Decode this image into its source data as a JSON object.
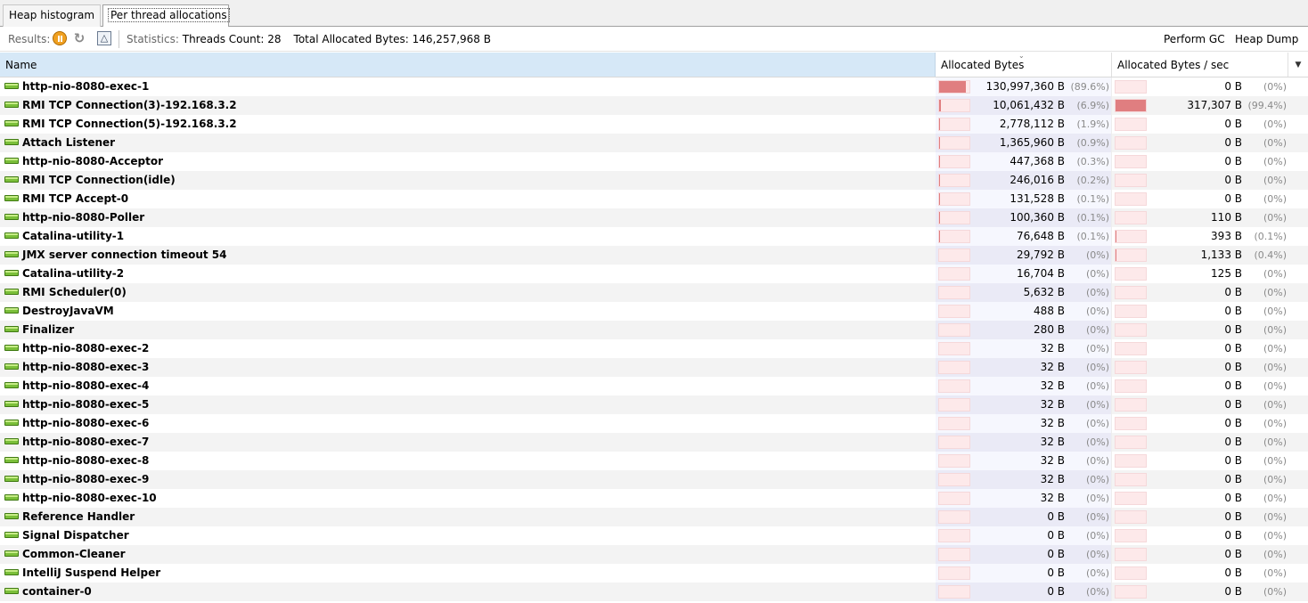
{
  "tabs": [
    {
      "label": "Heap histogram",
      "active": false
    },
    {
      "label": "Per thread allocations",
      "active": true
    }
  ],
  "toolbar": {
    "results_label": "Results:",
    "icons": [
      "pause-icon",
      "refresh-icon",
      "delta-icon"
    ],
    "statistics_label": "Statistics:",
    "threads_count": "Threads Count: 28",
    "total_allocated": "Total Allocated Bytes: 146,257,968 B",
    "perform_gc": "Perform GC",
    "heap_dump": "Heap Dump"
  },
  "columns": {
    "name": "Name",
    "allocated_bytes": "Allocated Bytes",
    "allocated_bytes_sec": "Allocated Bytes / sec"
  },
  "colors": {
    "bar_fill": "#e07e80",
    "bar_bg": "#fde9ea",
    "header_selected": "#d6e8f7",
    "thread_icon": "#7bbf3a"
  },
  "rows": [
    {
      "name": "http-nio-8080-exec-1",
      "bytes": "130,997,360 B",
      "bytes_pct": "(89.6%)",
      "bytes_frac": 0.896,
      "rate": "0 B",
      "rate_pct": "(0%)",
      "rate_frac": 0
    },
    {
      "name": "RMI TCP Connection(3)-192.168.3.2",
      "bytes": "10,061,432 B",
      "bytes_pct": "(6.9%)",
      "bytes_frac": 0.069,
      "rate": "317,307 B",
      "rate_pct": "(99.4%)",
      "rate_frac": 0.994
    },
    {
      "name": "RMI TCP Connection(5)-192.168.3.2",
      "bytes": "2,778,112 B",
      "bytes_pct": "(1.9%)",
      "bytes_frac": 0.019,
      "rate": "0 B",
      "rate_pct": "(0%)",
      "rate_frac": 0
    },
    {
      "name": "Attach Listener",
      "bytes": "1,365,960 B",
      "bytes_pct": "(0.9%)",
      "bytes_frac": 0.009,
      "rate": "0 B",
      "rate_pct": "(0%)",
      "rate_frac": 0
    },
    {
      "name": "http-nio-8080-Acceptor",
      "bytes": "447,368 B",
      "bytes_pct": "(0.3%)",
      "bytes_frac": 0.003,
      "rate": "0 B",
      "rate_pct": "(0%)",
      "rate_frac": 0
    },
    {
      "name": "RMI TCP Connection(idle)",
      "bytes": "246,016 B",
      "bytes_pct": "(0.2%)",
      "bytes_frac": 0.002,
      "rate": "0 B",
      "rate_pct": "(0%)",
      "rate_frac": 0
    },
    {
      "name": "RMI TCP Accept-0",
      "bytes": "131,528 B",
      "bytes_pct": "(0.1%)",
      "bytes_frac": 0.001,
      "rate": "0 B",
      "rate_pct": "(0%)",
      "rate_frac": 0
    },
    {
      "name": "http-nio-8080-Poller",
      "bytes": "100,360 B",
      "bytes_pct": "(0.1%)",
      "bytes_frac": 0.001,
      "rate": "110 B",
      "rate_pct": "(0%)",
      "rate_frac": 0
    },
    {
      "name": "Catalina-utility-1",
      "bytes": "76,648 B",
      "bytes_pct": "(0.1%)",
      "bytes_frac": 0.001,
      "rate": "393 B",
      "rate_pct": "(0.1%)",
      "rate_frac": 0.001
    },
    {
      "name": "JMX server connection timeout 54",
      "bytes": "29,792 B",
      "bytes_pct": "(0%)",
      "bytes_frac": 0,
      "rate": "1,133 B",
      "rate_pct": "(0.4%)",
      "rate_frac": 0.004
    },
    {
      "name": "Catalina-utility-2",
      "bytes": "16,704 B",
      "bytes_pct": "(0%)",
      "bytes_frac": 0,
      "rate": "125 B",
      "rate_pct": "(0%)",
      "rate_frac": 0
    },
    {
      "name": "RMI Scheduler(0)",
      "bytes": "5,632 B",
      "bytes_pct": "(0%)",
      "bytes_frac": 0,
      "rate": "0 B",
      "rate_pct": "(0%)",
      "rate_frac": 0
    },
    {
      "name": "DestroyJavaVM",
      "bytes": "488 B",
      "bytes_pct": "(0%)",
      "bytes_frac": 0,
      "rate": "0 B",
      "rate_pct": "(0%)",
      "rate_frac": 0
    },
    {
      "name": "Finalizer",
      "bytes": "280 B",
      "bytes_pct": "(0%)",
      "bytes_frac": 0,
      "rate": "0 B",
      "rate_pct": "(0%)",
      "rate_frac": 0
    },
    {
      "name": "http-nio-8080-exec-2",
      "bytes": "32 B",
      "bytes_pct": "(0%)",
      "bytes_frac": 0,
      "rate": "0 B",
      "rate_pct": "(0%)",
      "rate_frac": 0
    },
    {
      "name": "http-nio-8080-exec-3",
      "bytes": "32 B",
      "bytes_pct": "(0%)",
      "bytes_frac": 0,
      "rate": "0 B",
      "rate_pct": "(0%)",
      "rate_frac": 0
    },
    {
      "name": "http-nio-8080-exec-4",
      "bytes": "32 B",
      "bytes_pct": "(0%)",
      "bytes_frac": 0,
      "rate": "0 B",
      "rate_pct": "(0%)",
      "rate_frac": 0
    },
    {
      "name": "http-nio-8080-exec-5",
      "bytes": "32 B",
      "bytes_pct": "(0%)",
      "bytes_frac": 0,
      "rate": "0 B",
      "rate_pct": "(0%)",
      "rate_frac": 0
    },
    {
      "name": "http-nio-8080-exec-6",
      "bytes": "32 B",
      "bytes_pct": "(0%)",
      "bytes_frac": 0,
      "rate": "0 B",
      "rate_pct": "(0%)",
      "rate_frac": 0
    },
    {
      "name": "http-nio-8080-exec-7",
      "bytes": "32 B",
      "bytes_pct": "(0%)",
      "bytes_frac": 0,
      "rate": "0 B",
      "rate_pct": "(0%)",
      "rate_frac": 0
    },
    {
      "name": "http-nio-8080-exec-8",
      "bytes": "32 B",
      "bytes_pct": "(0%)",
      "bytes_frac": 0,
      "rate": "0 B",
      "rate_pct": "(0%)",
      "rate_frac": 0
    },
    {
      "name": "http-nio-8080-exec-9",
      "bytes": "32 B",
      "bytes_pct": "(0%)",
      "bytes_frac": 0,
      "rate": "0 B",
      "rate_pct": "(0%)",
      "rate_frac": 0
    },
    {
      "name": "http-nio-8080-exec-10",
      "bytes": "32 B",
      "bytes_pct": "(0%)",
      "bytes_frac": 0,
      "rate": "0 B",
      "rate_pct": "(0%)",
      "rate_frac": 0
    },
    {
      "name": "Reference Handler",
      "bytes": "0 B",
      "bytes_pct": "(0%)",
      "bytes_frac": 0,
      "rate": "0 B",
      "rate_pct": "(0%)",
      "rate_frac": 0
    },
    {
      "name": "Signal Dispatcher",
      "bytes": "0 B",
      "bytes_pct": "(0%)",
      "bytes_frac": 0,
      "rate": "0 B",
      "rate_pct": "(0%)",
      "rate_frac": 0
    },
    {
      "name": "Common-Cleaner",
      "bytes": "0 B",
      "bytes_pct": "(0%)",
      "bytes_frac": 0,
      "rate": "0 B",
      "rate_pct": "(0%)",
      "rate_frac": 0
    },
    {
      "name": "IntelliJ Suspend Helper",
      "bytes": "0 B",
      "bytes_pct": "(0%)",
      "bytes_frac": 0,
      "rate": "0 B",
      "rate_pct": "(0%)",
      "rate_frac": 0
    },
    {
      "name": "container-0",
      "bytes": "0 B",
      "bytes_pct": "(0%)",
      "bytes_frac": 0,
      "rate": "0 B",
      "rate_pct": "(0%)",
      "rate_frac": 0
    }
  ]
}
